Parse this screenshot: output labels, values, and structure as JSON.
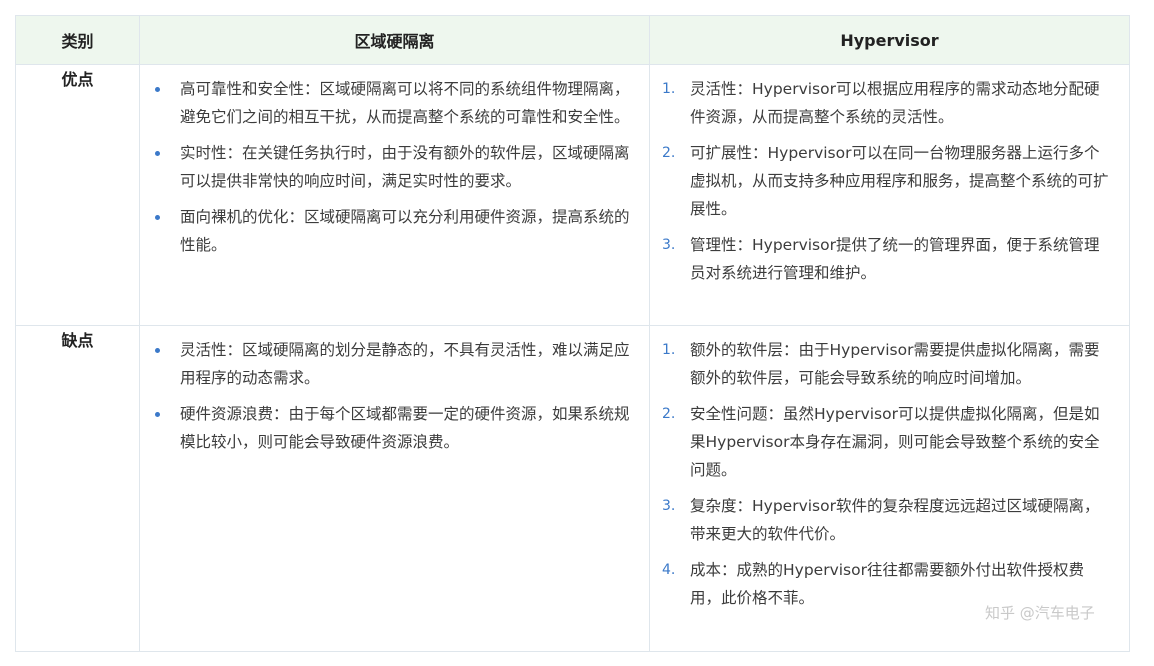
{
  "table": {
    "headers": [
      "类别",
      "区域硬隔离",
      "Hypervisor"
    ],
    "rows": [
      {
        "category": "优点",
        "zone_isolation": [
          "高可靠性和安全性：区域硬隔离可以将不同的系统组件物理隔离，避免它们之间的相互干扰，从而提高整个系统的可靠性和安全性。",
          "实时性：在关键任务执行时，由于没有额外的软件层，区域硬隔离可以提供非常快的响应时间，满足实时性的要求。",
          "面向裸机的优化：区域硬隔离可以充分利用硬件资源，提高系统的性能。"
        ],
        "hypervisor": [
          {
            "num": "1.",
            "text": "灵活性：Hypervisor可以根据应用程序的需求动态地分配硬件资源，从而提高整个系统的灵活性。"
          },
          {
            "num": "2.",
            "text": "可扩展性：Hypervisor可以在同一台物理服务器上运行多个虚拟机，从而支持多种应用程序和服务，提高整个系统的可扩展性。"
          },
          {
            "num": "3.",
            "text": "管理性：Hypervisor提供了统一的管理界面，便于系统管理员对系统进行管理和维护。"
          }
        ]
      },
      {
        "category": "缺点",
        "zone_isolation": [
          "灵活性：区域硬隔离的划分是静态的，不具有灵活性，难以满足应用程序的动态需求。",
          "硬件资源浪费：由于每个区域都需要一定的硬件资源，如果系统规模比较小，则可能会导致硬件资源浪费。"
        ],
        "hypervisor": [
          {
            "num": "1.",
            "text": "额外的软件层：由于Hypervisor需要提供虚拟化隔离，需要额外的软件层，可能会导致系统的响应时间增加。"
          },
          {
            "num": "2.",
            "text": "安全性问题：虽然Hypervisor可以提供虚拟化隔离，但是如果Hypervisor本身存在漏洞，则可能会导致整个系统的安全问题。"
          },
          {
            "num": "3.",
            "text": "复杂度：Hypervisor软件的复杂程度远远超过区域硬隔离，带来更大的软件代价。"
          },
          {
            "num": "4.",
            "text": "成本：成熟的Hypervisor往往都需要额外付出软件授权费用，此价格不菲。"
          }
        ]
      }
    ]
  },
  "watermark": "知乎 @汽车电子"
}
